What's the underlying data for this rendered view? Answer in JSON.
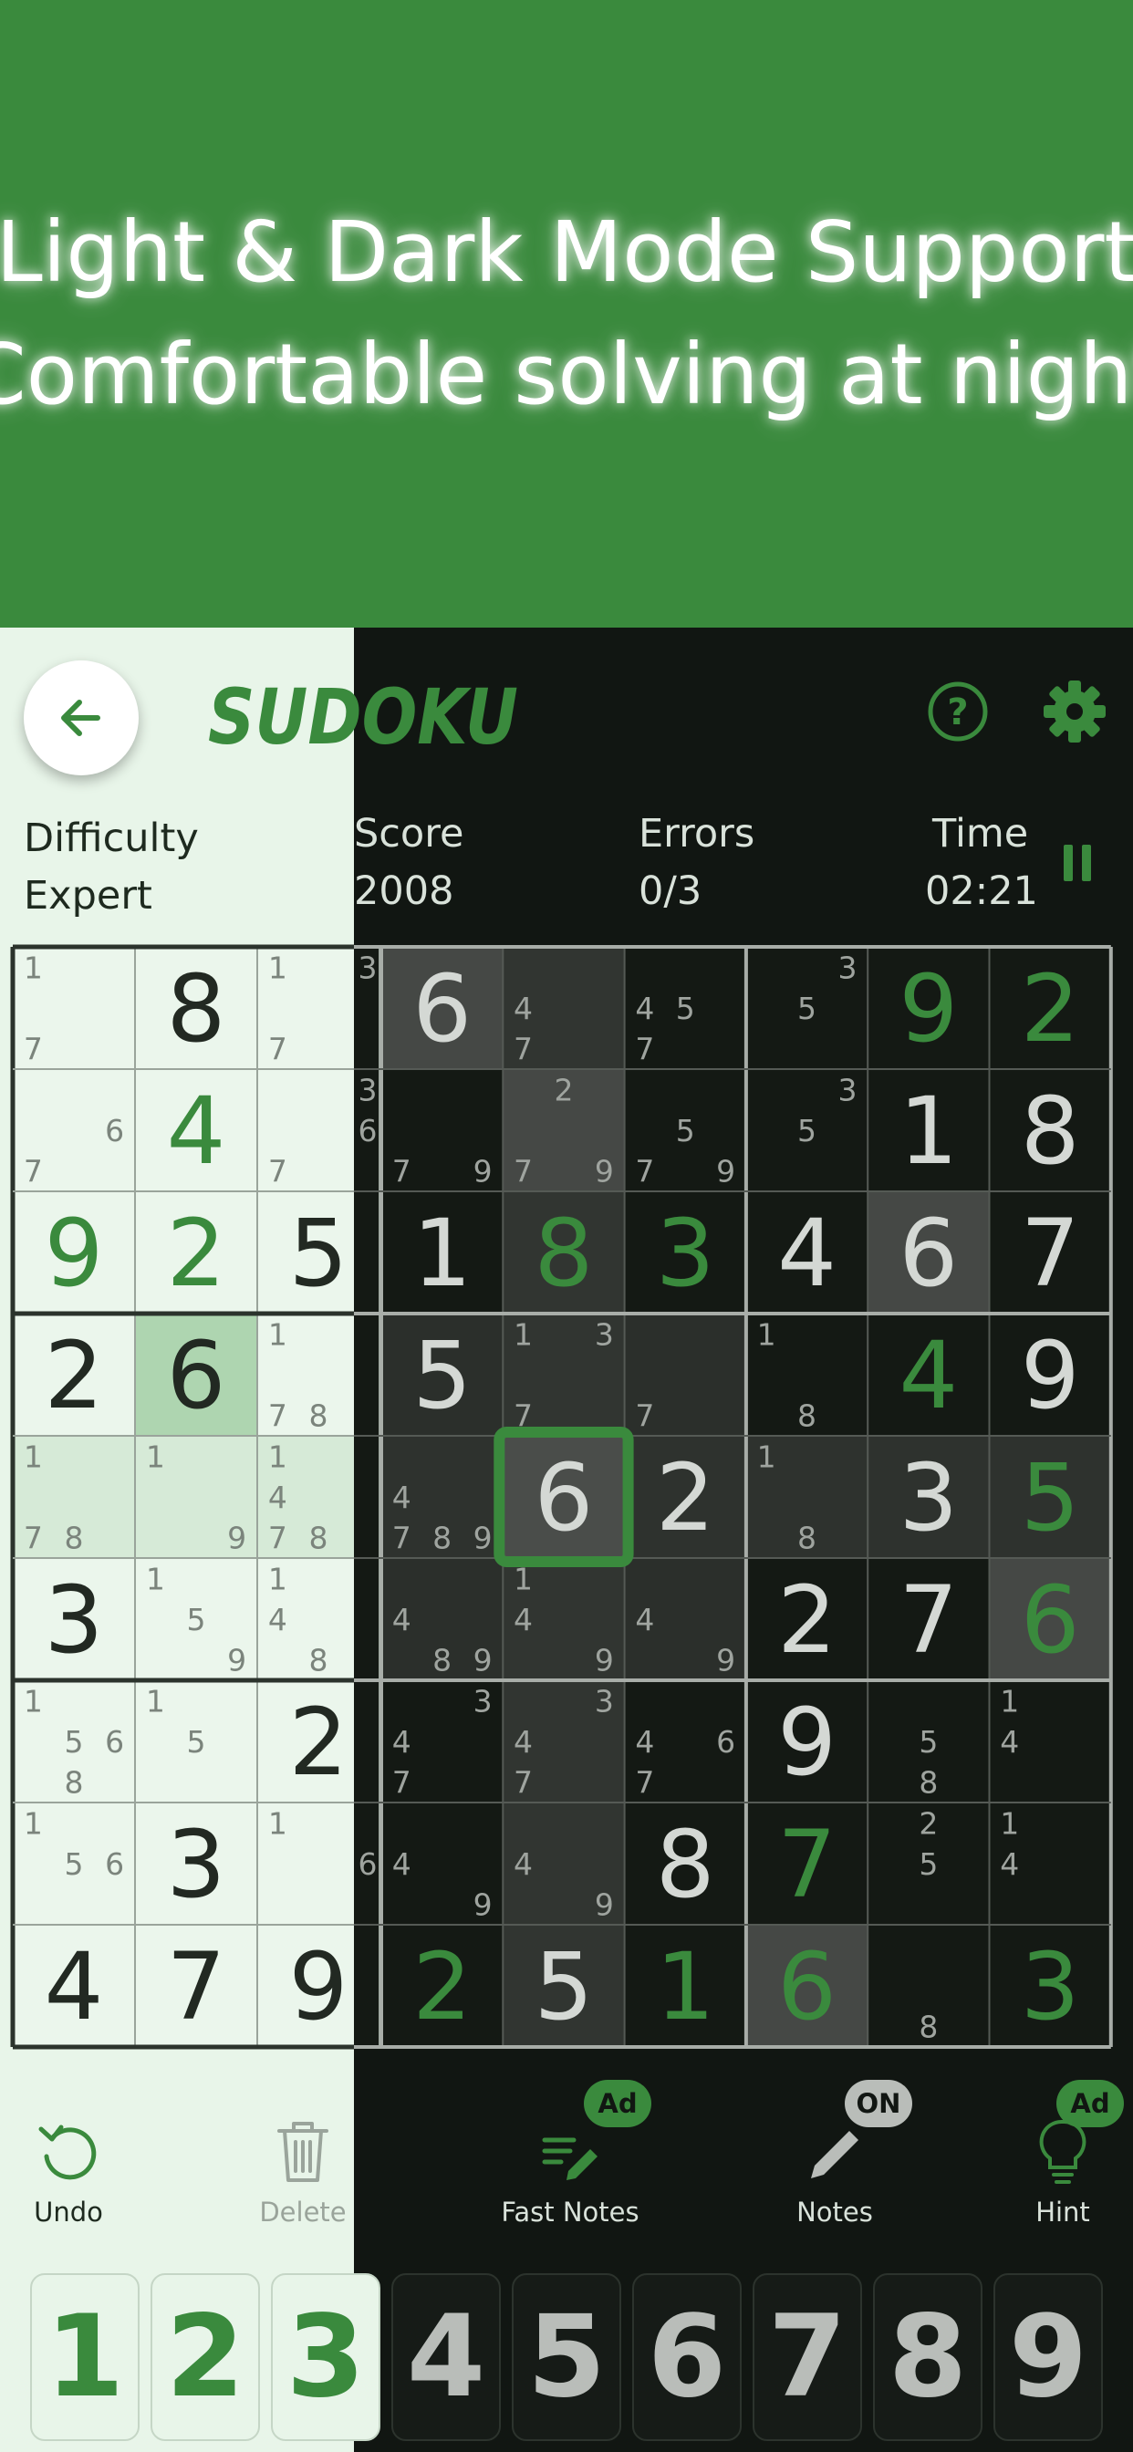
{
  "banner": {
    "line1": "Light & Dark Mode Support",
    "line2": "Comfortable solving at night"
  },
  "header": {
    "logo_text": "SUDOKU",
    "back_icon": "arrow-left-icon",
    "help_icon": "question-circle-icon",
    "settings_icon": "gear-icon"
  },
  "stats": {
    "difficulty_label": "Difficulty",
    "difficulty_value": "Expert",
    "score_label": "Score",
    "score_value": "2008",
    "errors_label": "Errors",
    "errors_value": "0/3",
    "time_label": "Time",
    "time_value": "02:21",
    "pause_icon": "pause-icon"
  },
  "board": {
    "cells": [
      [
        "n:1,7",
        "8",
        "n:1,7",
        "n:3",
        "6",
        "n:4,7",
        "n:4,5,7",
        "n:3,5",
        "9g",
        "2g"
      ],
      [
        "n:6,7",
        "4g",
        "n:7",
        "n:3,6",
        "n:7,9",
        "n:2,7,9",
        "n:5,7,9",
        "n:3,5",
        "1",
        "8"
      ],
      [
        "9g",
        "2g",
        "5",
        "",
        "1",
        "8g",
        "3g",
        "4",
        "6",
        "7"
      ],
      [
        "2",
        "6",
        "n:1,7,8",
        "",
        "5",
        "n:1,3,7",
        "n:7",
        "n:1,8",
        "4g",
        "9"
      ],
      [
        "n:1,7,8",
        "n:1,9",
        "n:1,4,7,8",
        "",
        "n:4,7,8,9",
        "6",
        "2",
        "n:1,8",
        "3",
        "5g"
      ],
      [
        "3",
        "n:1,5,9",
        "n:1,4,8",
        "",
        "n:4,8,9",
        "n:1,4,9",
        "n:4,9",
        "2",
        "7",
        "6g"
      ],
      [
        "n:1,5,6,8",
        "n:1,5",
        "2",
        "",
        "n:3,4,7",
        "n:3,4,7",
        "n:4,6,7",
        "9",
        "n:5,8",
        "n:1,4"
      ],
      [
        "n:1,5,6",
        "3",
        "n:1",
        "n:6",
        "n:4,9",
        "n:4,9",
        "8",
        "7g",
        "n:2,5",
        "n:1,4"
      ],
      [
        "4",
        "7",
        "9",
        "",
        "2g",
        "5",
        "1g",
        "6g",
        "n:8",
        "3g"
      ]
    ]
  },
  "tools": {
    "undo_label": "Undo",
    "undo_icon": "undo-icon",
    "delete_label": "Delete",
    "delete_icon": "trash-icon",
    "fast_notes_label": "Fast Notes",
    "fast_notes_icon": "fast-notes-icon",
    "fast_notes_badge": "Ad",
    "notes_label": "Notes",
    "notes_icon": "pencil-icon",
    "notes_badge": "ON",
    "hint_label": "Hint",
    "hint_icon": "lightbulb-icon",
    "hint_badge": "Ad"
  },
  "numpad": [
    "1",
    "2",
    "3",
    "4",
    "5",
    "6",
    "7",
    "8",
    "9"
  ],
  "colors": {
    "brand_green": "#3a8a3d",
    "light_bg": "#e8f5e9",
    "dark_bg": "#111612"
  }
}
